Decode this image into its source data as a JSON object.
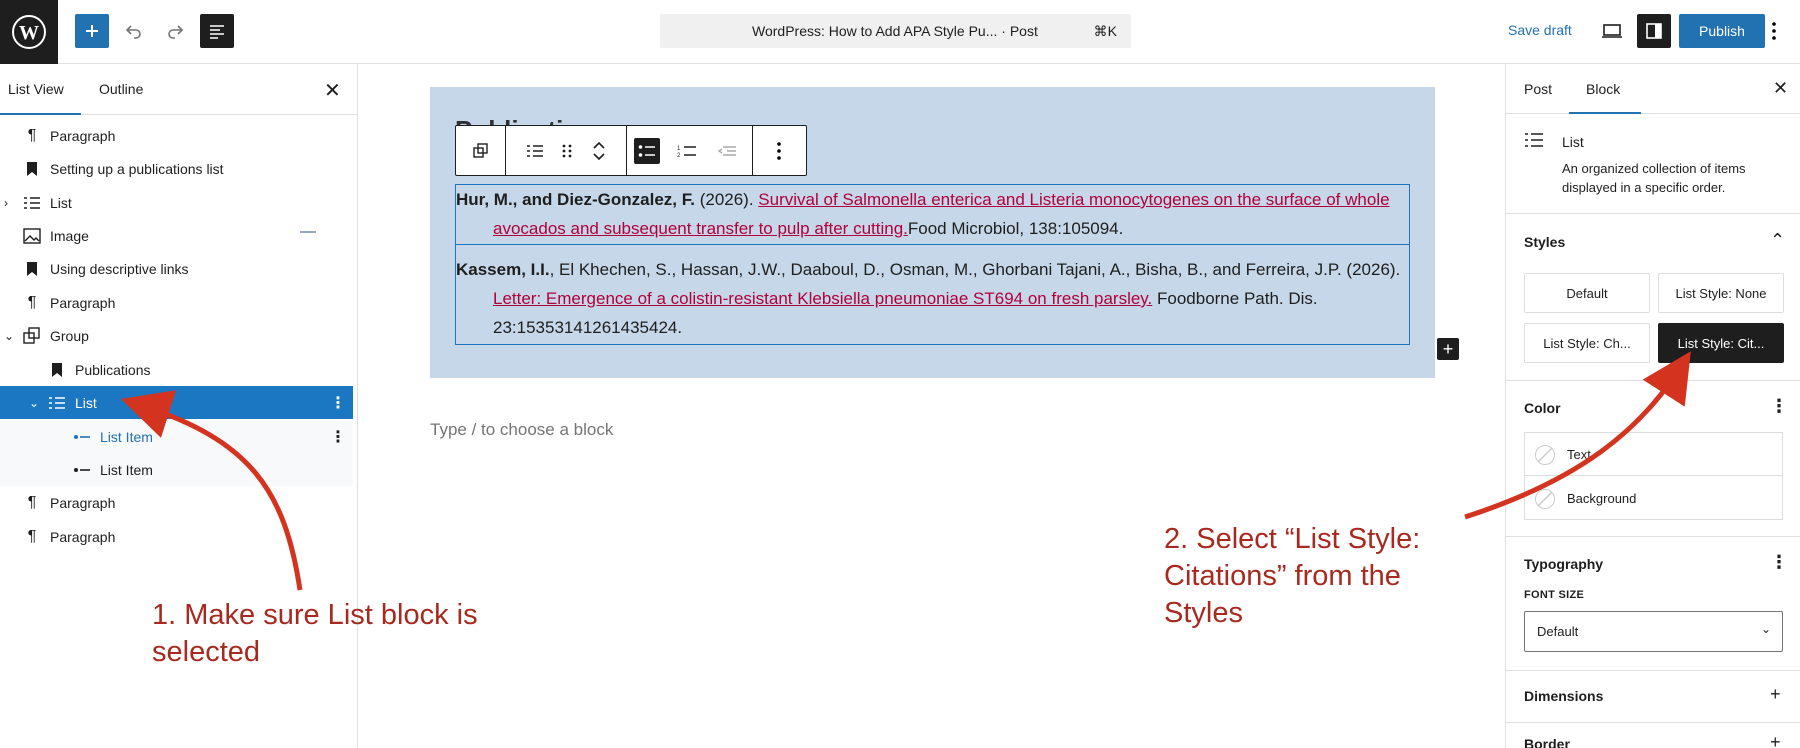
{
  "topbar": {
    "document_title": "WordPress: How to Add APA Style Pu... · Post",
    "shortcut": "⌘K",
    "save_draft": "Save draft",
    "publish": "Publish",
    "icons": [
      "wordpress-logo-icon",
      "plus-icon",
      "undo-icon",
      "redo-icon",
      "document-overview-icon",
      "view-icon",
      "settings-sidebar-icon",
      "more-options-icon"
    ]
  },
  "left_sidebar": {
    "tabs": [
      "List View",
      "Outline"
    ],
    "items": [
      {
        "label": "Paragraph",
        "icon": "paragraph-icon"
      },
      {
        "label": "Setting up a publications list",
        "icon": "bookmark-icon"
      },
      {
        "label": "List",
        "icon": "list-icon"
      },
      {
        "label": "Image",
        "icon": "image-icon"
      },
      {
        "label": "Using descriptive links",
        "icon": "bookmark-icon"
      },
      {
        "label": "Paragraph",
        "icon": "paragraph-icon"
      },
      {
        "label": "Group",
        "icon": "group-icon"
      },
      {
        "label": "Publications",
        "icon": "bookmark-icon"
      },
      {
        "label": "List",
        "icon": "list-icon"
      },
      {
        "label": "List Item",
        "icon": "list-item-icon"
      },
      {
        "label": "List Item",
        "icon": "list-item-icon"
      },
      {
        "label": "Paragraph",
        "icon": "paragraph-icon"
      },
      {
        "label": "Paragraph",
        "icon": "paragraph-icon"
      }
    ]
  },
  "canvas": {
    "group_heading": "Publications",
    "list_items": [
      {
        "authors": "Hur, M., and Diez-Gonzalez, F.",
        "year": " (2026). ",
        "link": "Survival of Salmonella enterica and Listeria monocytogenes on the surface of whole avocados and subsequent transfer to pulp after cutting.",
        "rest": "Food Microbiol, 138:105094."
      },
      {
        "authors": "Kassem, I.I.",
        "rest_before": ", El Khechen, S., Hassan, J.W., Daaboul, D., Osman, M., Ghorbani Tajani, A., Bisha, B., and Ferreira, J.P. (2026).",
        "link": "Letter: Emergence of a colistin-resistant Klebsiella pneumoniae ST694 on fresh parsley.",
        "rest": " Foodborne Path. Dis. 23:15353141261435424."
      }
    ],
    "placeholder": "Type / to choose a block"
  },
  "right_sidebar": {
    "tabs": [
      "Post",
      "Block"
    ],
    "block_name": "List",
    "block_description": "An organized collection of items displayed in a specific order.",
    "styles_heading": "Styles",
    "styles": [
      "Default",
      "List Style: None",
      "List Style: Ch...",
      "List Style: Cit..."
    ],
    "active_style_index": 3,
    "color_heading": "Color",
    "color_items": [
      "Text",
      "Background"
    ],
    "typography_heading": "Typography",
    "font_size_label": "FONT SIZE",
    "font_size_value": "Default",
    "dimensions_heading": "Dimensions",
    "border_heading": "Border"
  },
  "annotations": {
    "step1": "1. Make sure List block is selected",
    "step2": "2. Select “List Style: Citations” from the Styles",
    "color": "#a72a20"
  }
}
